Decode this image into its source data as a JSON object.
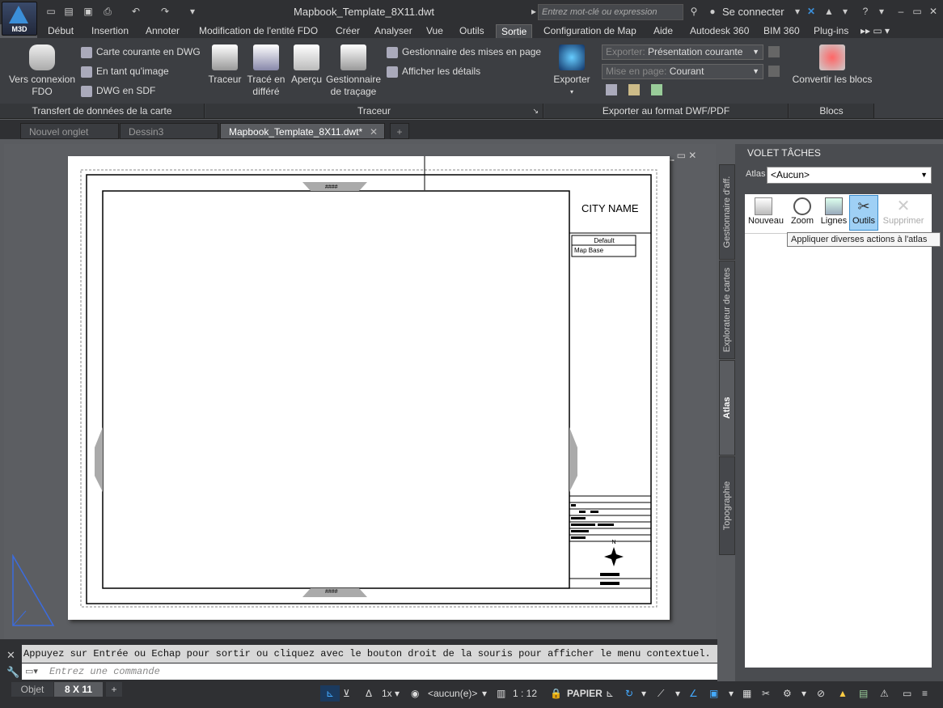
{
  "app": {
    "logo_label": "M3D",
    "window_title": "Mapbook_Template_8X11.dwt",
    "search_placeholder": "Entrez mot-clé ou expression",
    "signin": "Se connecter"
  },
  "ribbon_tabs": [
    "Début",
    "Insertion",
    "Annoter",
    "Modification de l'entité FDO",
    "Créer",
    "Analyser",
    "Vue",
    "Outils",
    "Sortie",
    "Configuration de Map",
    "Aide",
    "Autodesk 360",
    "BIM 360",
    "Plug-ins"
  ],
  "active_tab": "Sortie",
  "panels": {
    "transfer": {
      "title": "Transfert de données de la carte",
      "big_button": "Vers connexion FDO",
      "items": [
        "Carte courante en DWG",
        "En tant qu'image",
        "DWG en SDF"
      ]
    },
    "plot": {
      "title": "Traceur",
      "buttons": [
        "Traceur",
        "Tracé en différé",
        "Aperçu",
        "Gestionnaire de traçage"
      ],
      "items": [
        "Gestionnaire des mises en page",
        "Afficher les détails"
      ]
    },
    "export": {
      "title": "Exporter au format DWF/PDF",
      "button": "Exporter",
      "export_label": "Exporter:",
      "export_value": "Présentation courante",
      "pagesetup_label": "Mise en page:",
      "pagesetup_value": "Courant"
    },
    "blocks": {
      "title": "Blocs",
      "button": "Convertir les blocs"
    }
  },
  "file_tabs": [
    "Nouvel onglet",
    "Dessin3",
    "Mapbook_Template_8X11.dwt*"
  ],
  "drawing": {
    "title_block_city": "CITY NAME",
    "legend_header": "Default",
    "legend_row": "Map Base",
    "arrow_marks": "####"
  },
  "task_pane": {
    "title": "VOLET TÂCHES",
    "atlas_label": "Atlas",
    "atlas_value": "<Aucun>",
    "tools": [
      "Nouveau",
      "Zoom",
      "Lignes",
      "Outils",
      "Supprimer"
    ],
    "tooltip": "Appliquer diverses actions à l'atlas",
    "vertical_tabs": [
      "Gestionnaire d'aff.",
      "Explorateur de cartes",
      "Atlas",
      "Topographie"
    ]
  },
  "command": {
    "output": "Appuyez sur Entrée ou Echap pour sortir ou cliquez avec le bouton droit de la souris pour afficher le menu contextuel.",
    "placeholder": "Entrez une commande"
  },
  "status": {
    "layout_tabs": [
      "Objet",
      "8 X 11"
    ],
    "scale_factor": "1x",
    "annotation": "<aucun(e)>",
    "scale": "1 : 12",
    "space": "PAPIER"
  }
}
